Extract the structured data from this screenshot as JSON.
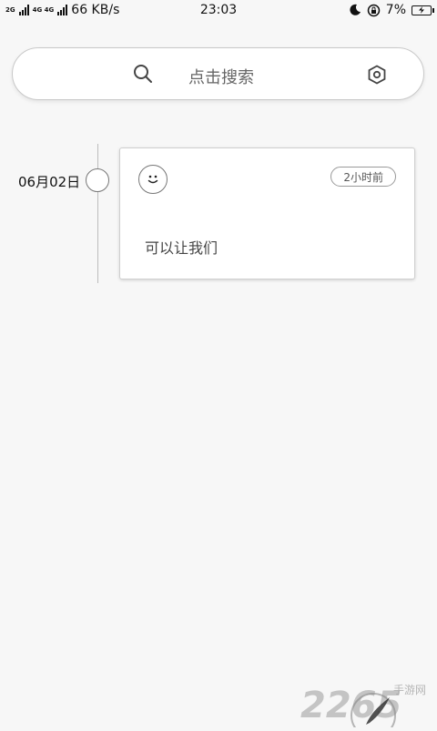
{
  "status_bar": {
    "net1": "2G",
    "net2": "4G 4G",
    "speed": "66 KB/s",
    "time": "23:03",
    "battery": "7%"
  },
  "search": {
    "placeholder": "点击搜索",
    "icon": "search-icon",
    "settings_icon": "settings-icon"
  },
  "timeline": {
    "date": "06月02日",
    "entries": [
      {
        "mood_icon": "smiley-icon",
        "time_ago": "2小时前",
        "text": "可以让我们"
      }
    ]
  },
  "watermark": {
    "text": "2265",
    "sub": "手游网"
  }
}
